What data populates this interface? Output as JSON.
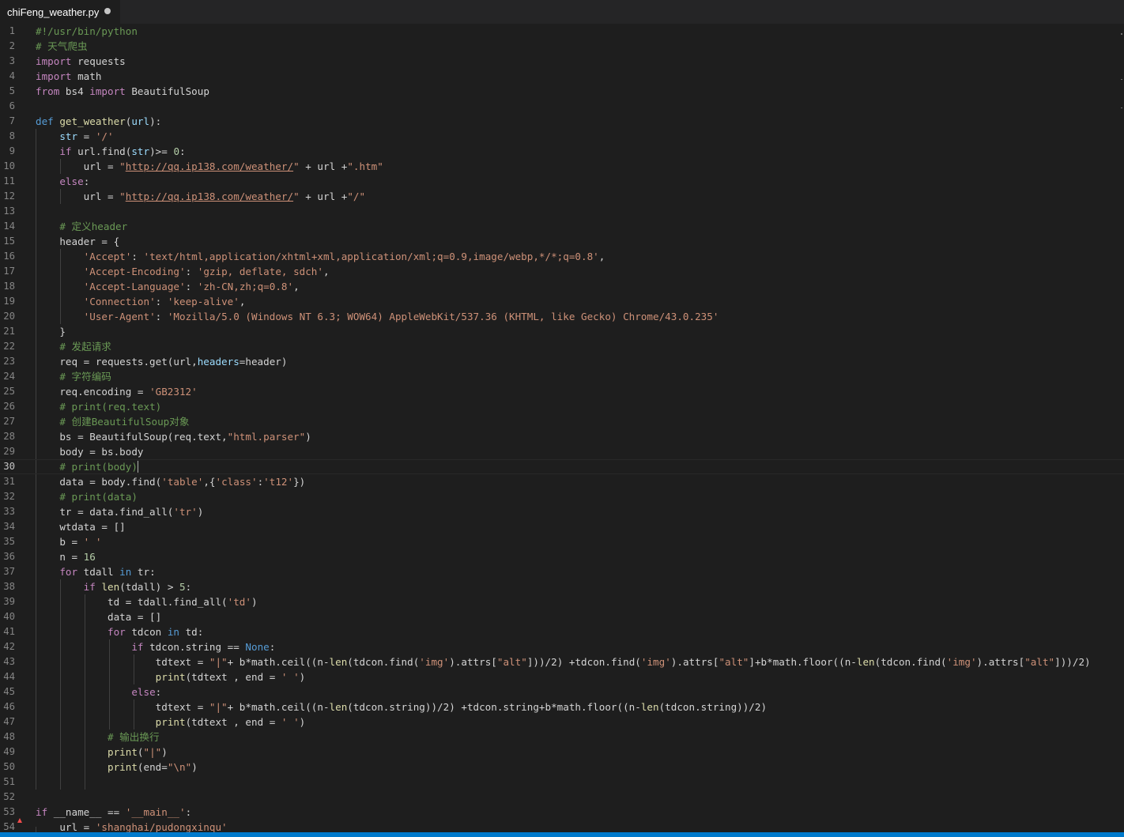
{
  "tab": {
    "title": "chiFeng_weather.py"
  },
  "editor": {
    "cursor_line": 30,
    "lines": [
      [
        [
          "#!/usr/bin/python",
          "com"
        ]
      ],
      [
        [
          "# 天气爬虫",
          "com"
        ]
      ],
      [
        [
          "import",
          "ctl"
        ],
        [
          " requests",
          ""
        ]
      ],
      [
        [
          "import",
          "ctl"
        ],
        [
          " math",
          ""
        ]
      ],
      [
        [
          "from",
          "ctl"
        ],
        [
          " bs4 ",
          ""
        ],
        [
          "import",
          "ctl"
        ],
        [
          " BeautifulSoup",
          ""
        ]
      ],
      [],
      [
        [
          "def",
          "kw"
        ],
        [
          " ",
          ""
        ],
        [
          "get_weather",
          "fn"
        ],
        [
          "(",
          ""
        ],
        [
          "url",
          "var"
        ],
        [
          "):",
          ""
        ]
      ],
      [
        [
          "    ",
          ""
        ],
        [
          "str",
          "var"
        ],
        [
          " = ",
          ""
        ],
        [
          "'/'",
          "str"
        ]
      ],
      [
        [
          "    ",
          ""
        ],
        [
          "if",
          "ctl"
        ],
        [
          " url.find(",
          ""
        ],
        [
          "str",
          "var"
        ],
        [
          ")>= ",
          ""
        ],
        [
          "0",
          "num"
        ],
        [
          ":",
          ""
        ]
      ],
      [
        [
          "        url = ",
          ""
        ],
        [
          "\"",
          "str"
        ],
        [
          "http://qq.ip138.com/weather/",
          "url"
        ],
        [
          "\"",
          "str"
        ],
        [
          " + url +",
          ""
        ],
        [
          "\".htm\"",
          "str"
        ]
      ],
      [
        [
          "    ",
          ""
        ],
        [
          "else",
          "ctl"
        ],
        [
          ":",
          ""
        ]
      ],
      [
        [
          "        url = ",
          ""
        ],
        [
          "\"",
          "str"
        ],
        [
          "http://qq.ip138.com/weather/",
          "url"
        ],
        [
          "\"",
          "str"
        ],
        [
          " + url +",
          ""
        ],
        [
          "\"/\"",
          "str"
        ]
      ],
      [],
      [
        [
          "    ",
          ""
        ],
        [
          "# 定义header",
          "com"
        ]
      ],
      [
        [
          "    header = {",
          ""
        ]
      ],
      [
        [
          "        ",
          ""
        ],
        [
          "'Accept'",
          "str"
        ],
        [
          ": ",
          ""
        ],
        [
          "'text/html,application/xhtml+xml,application/xml;q=0.9,image/webp,*/*;q=0.8'",
          "str"
        ],
        [
          ",",
          ""
        ]
      ],
      [
        [
          "        ",
          ""
        ],
        [
          "'Accept-Encoding'",
          "str"
        ],
        [
          ": ",
          ""
        ],
        [
          "'gzip, deflate, sdch'",
          "str"
        ],
        [
          ",",
          ""
        ]
      ],
      [
        [
          "        ",
          ""
        ],
        [
          "'Accept-Language'",
          "str"
        ],
        [
          ": ",
          ""
        ],
        [
          "'zh-CN,zh;q=0.8'",
          "str"
        ],
        [
          ",",
          ""
        ]
      ],
      [
        [
          "        ",
          ""
        ],
        [
          "'Connection'",
          "str"
        ],
        [
          ": ",
          ""
        ],
        [
          "'keep-alive'",
          "str"
        ],
        [
          ",",
          ""
        ]
      ],
      [
        [
          "        ",
          ""
        ],
        [
          "'User-Agent'",
          "str"
        ],
        [
          ": ",
          ""
        ],
        [
          "'Mozilla/5.0 (Windows NT 6.3; WOW64) AppleWebKit/537.36 (KHTML, like Gecko) Chrome/43.0.235'",
          "str"
        ]
      ],
      [
        [
          "    }",
          ""
        ]
      ],
      [
        [
          "    ",
          ""
        ],
        [
          "# 发起请求",
          "com"
        ]
      ],
      [
        [
          "    req = requests.get(url,",
          ""
        ],
        [
          "headers",
          "var"
        ],
        [
          "=header)",
          ""
        ]
      ],
      [
        [
          "    ",
          ""
        ],
        [
          "# 字符编码",
          "com"
        ]
      ],
      [
        [
          "    req.encoding = ",
          ""
        ],
        [
          "'GB2312'",
          "str"
        ]
      ],
      [
        [
          "    ",
          ""
        ],
        [
          "# print(req.text)",
          "com"
        ]
      ],
      [
        [
          "    ",
          ""
        ],
        [
          "# 创建BeautifulSoup对象",
          "com"
        ]
      ],
      [
        [
          "    bs = BeautifulSoup(req.text,",
          ""
        ],
        [
          "\"html.parser\"",
          "str"
        ],
        [
          ")",
          ""
        ]
      ],
      [
        [
          "    body = bs.body",
          ""
        ]
      ],
      [
        [
          "    ",
          ""
        ],
        [
          "# print(body)",
          "com"
        ]
      ],
      [
        [
          "    data = body.find(",
          ""
        ],
        [
          "'table'",
          "str"
        ],
        [
          ",{",
          ""
        ],
        [
          "'class'",
          "str"
        ],
        [
          ":",
          ""
        ],
        [
          "'t12'",
          "str"
        ],
        [
          "})",
          ""
        ]
      ],
      [
        [
          "    ",
          ""
        ],
        [
          "# print(data)",
          "com"
        ]
      ],
      [
        [
          "    tr = data.find_all(",
          ""
        ],
        [
          "'tr'",
          "str"
        ],
        [
          ")",
          ""
        ]
      ],
      [
        [
          "    wtdata = []",
          ""
        ]
      ],
      [
        [
          "    b = ",
          ""
        ],
        [
          "' '",
          "str"
        ]
      ],
      [
        [
          "    n = ",
          ""
        ],
        [
          "16",
          "num"
        ]
      ],
      [
        [
          "    ",
          ""
        ],
        [
          "for",
          "ctl"
        ],
        [
          " tdall ",
          ""
        ],
        [
          "in",
          "kw"
        ],
        [
          " tr:",
          ""
        ]
      ],
      [
        [
          "        ",
          ""
        ],
        [
          "if",
          "ctl"
        ],
        [
          " ",
          ""
        ],
        [
          "len",
          "fn"
        ],
        [
          "(tdall) > ",
          ""
        ],
        [
          "5",
          "num"
        ],
        [
          ":",
          ""
        ]
      ],
      [
        [
          "            td = tdall.find_all(",
          ""
        ],
        [
          "'td'",
          "str"
        ],
        [
          ")",
          ""
        ]
      ],
      [
        [
          "            data = []",
          ""
        ]
      ],
      [
        [
          "            ",
          ""
        ],
        [
          "for",
          "ctl"
        ],
        [
          " tdcon ",
          ""
        ],
        [
          "in",
          "kw"
        ],
        [
          " td:",
          ""
        ]
      ],
      [
        [
          "                ",
          ""
        ],
        [
          "if",
          "ctl"
        ],
        [
          " tdcon.string == ",
          ""
        ],
        [
          "None",
          "kw"
        ],
        [
          ":",
          ""
        ]
      ],
      [
        [
          "                    tdtext = ",
          ""
        ],
        [
          "\"|\"",
          "str"
        ],
        [
          "+ b*math.ceil((n-",
          ""
        ],
        [
          "len",
          "fn"
        ],
        [
          "(tdcon.find(",
          ""
        ],
        [
          "'img'",
          "str"
        ],
        [
          ").attrs[",
          ""
        ],
        [
          "\"alt\"",
          "str"
        ],
        [
          "]))/2) +tdcon.find(",
          ""
        ],
        [
          "'img'",
          "str"
        ],
        [
          ").attrs[",
          ""
        ],
        [
          "\"alt\"",
          "str"
        ],
        [
          "]+b*math.floor((n-",
          ""
        ],
        [
          "len",
          "fn"
        ],
        [
          "(tdcon.find(",
          ""
        ],
        [
          "'img'",
          "str"
        ],
        [
          ").attrs[",
          ""
        ],
        [
          "\"alt\"",
          "str"
        ],
        [
          "]))/2)",
          ""
        ]
      ],
      [
        [
          "                    ",
          ""
        ],
        [
          "print",
          "fn"
        ],
        [
          "(tdtext , end = ",
          ""
        ],
        [
          "' '",
          "str"
        ],
        [
          ")",
          ""
        ]
      ],
      [
        [
          "                ",
          ""
        ],
        [
          "else",
          "ctl"
        ],
        [
          ":",
          ""
        ]
      ],
      [
        [
          "                    tdtext = ",
          ""
        ],
        [
          "\"|\"",
          "str"
        ],
        [
          "+ b*math.ceil((n-",
          ""
        ],
        [
          "len",
          "fn"
        ],
        [
          "(tdcon.string))/2) +tdcon.string+b*math.floor((n-",
          ""
        ],
        [
          "len",
          "fn"
        ],
        [
          "(tdcon.string))/2)",
          ""
        ]
      ],
      [
        [
          "                    ",
          ""
        ],
        [
          "print",
          "fn"
        ],
        [
          "(tdtext , end = ",
          ""
        ],
        [
          "' '",
          "str"
        ],
        [
          ")",
          ""
        ]
      ],
      [
        [
          "            ",
          ""
        ],
        [
          "# 输出换行",
          "com"
        ]
      ],
      [
        [
          "            ",
          ""
        ],
        [
          "print",
          "fn"
        ],
        [
          "(",
          ""
        ],
        [
          "\"|\"",
          "str"
        ],
        [
          ")",
          ""
        ]
      ],
      [
        [
          "            ",
          ""
        ],
        [
          "print",
          "fn"
        ],
        [
          "(end=",
          ""
        ],
        [
          "\"\\n\"",
          "str"
        ],
        [
          ")",
          ""
        ]
      ],
      [],
      [],
      [
        [
          "if",
          "ctl"
        ],
        [
          " __name__ == ",
          ""
        ],
        [
          "'__main__'",
          "str"
        ],
        [
          ":",
          ""
        ]
      ],
      [
        [
          "    url = ",
          ""
        ],
        [
          "'shanghai/pudongxinqu'",
          "str"
        ]
      ]
    ]
  }
}
